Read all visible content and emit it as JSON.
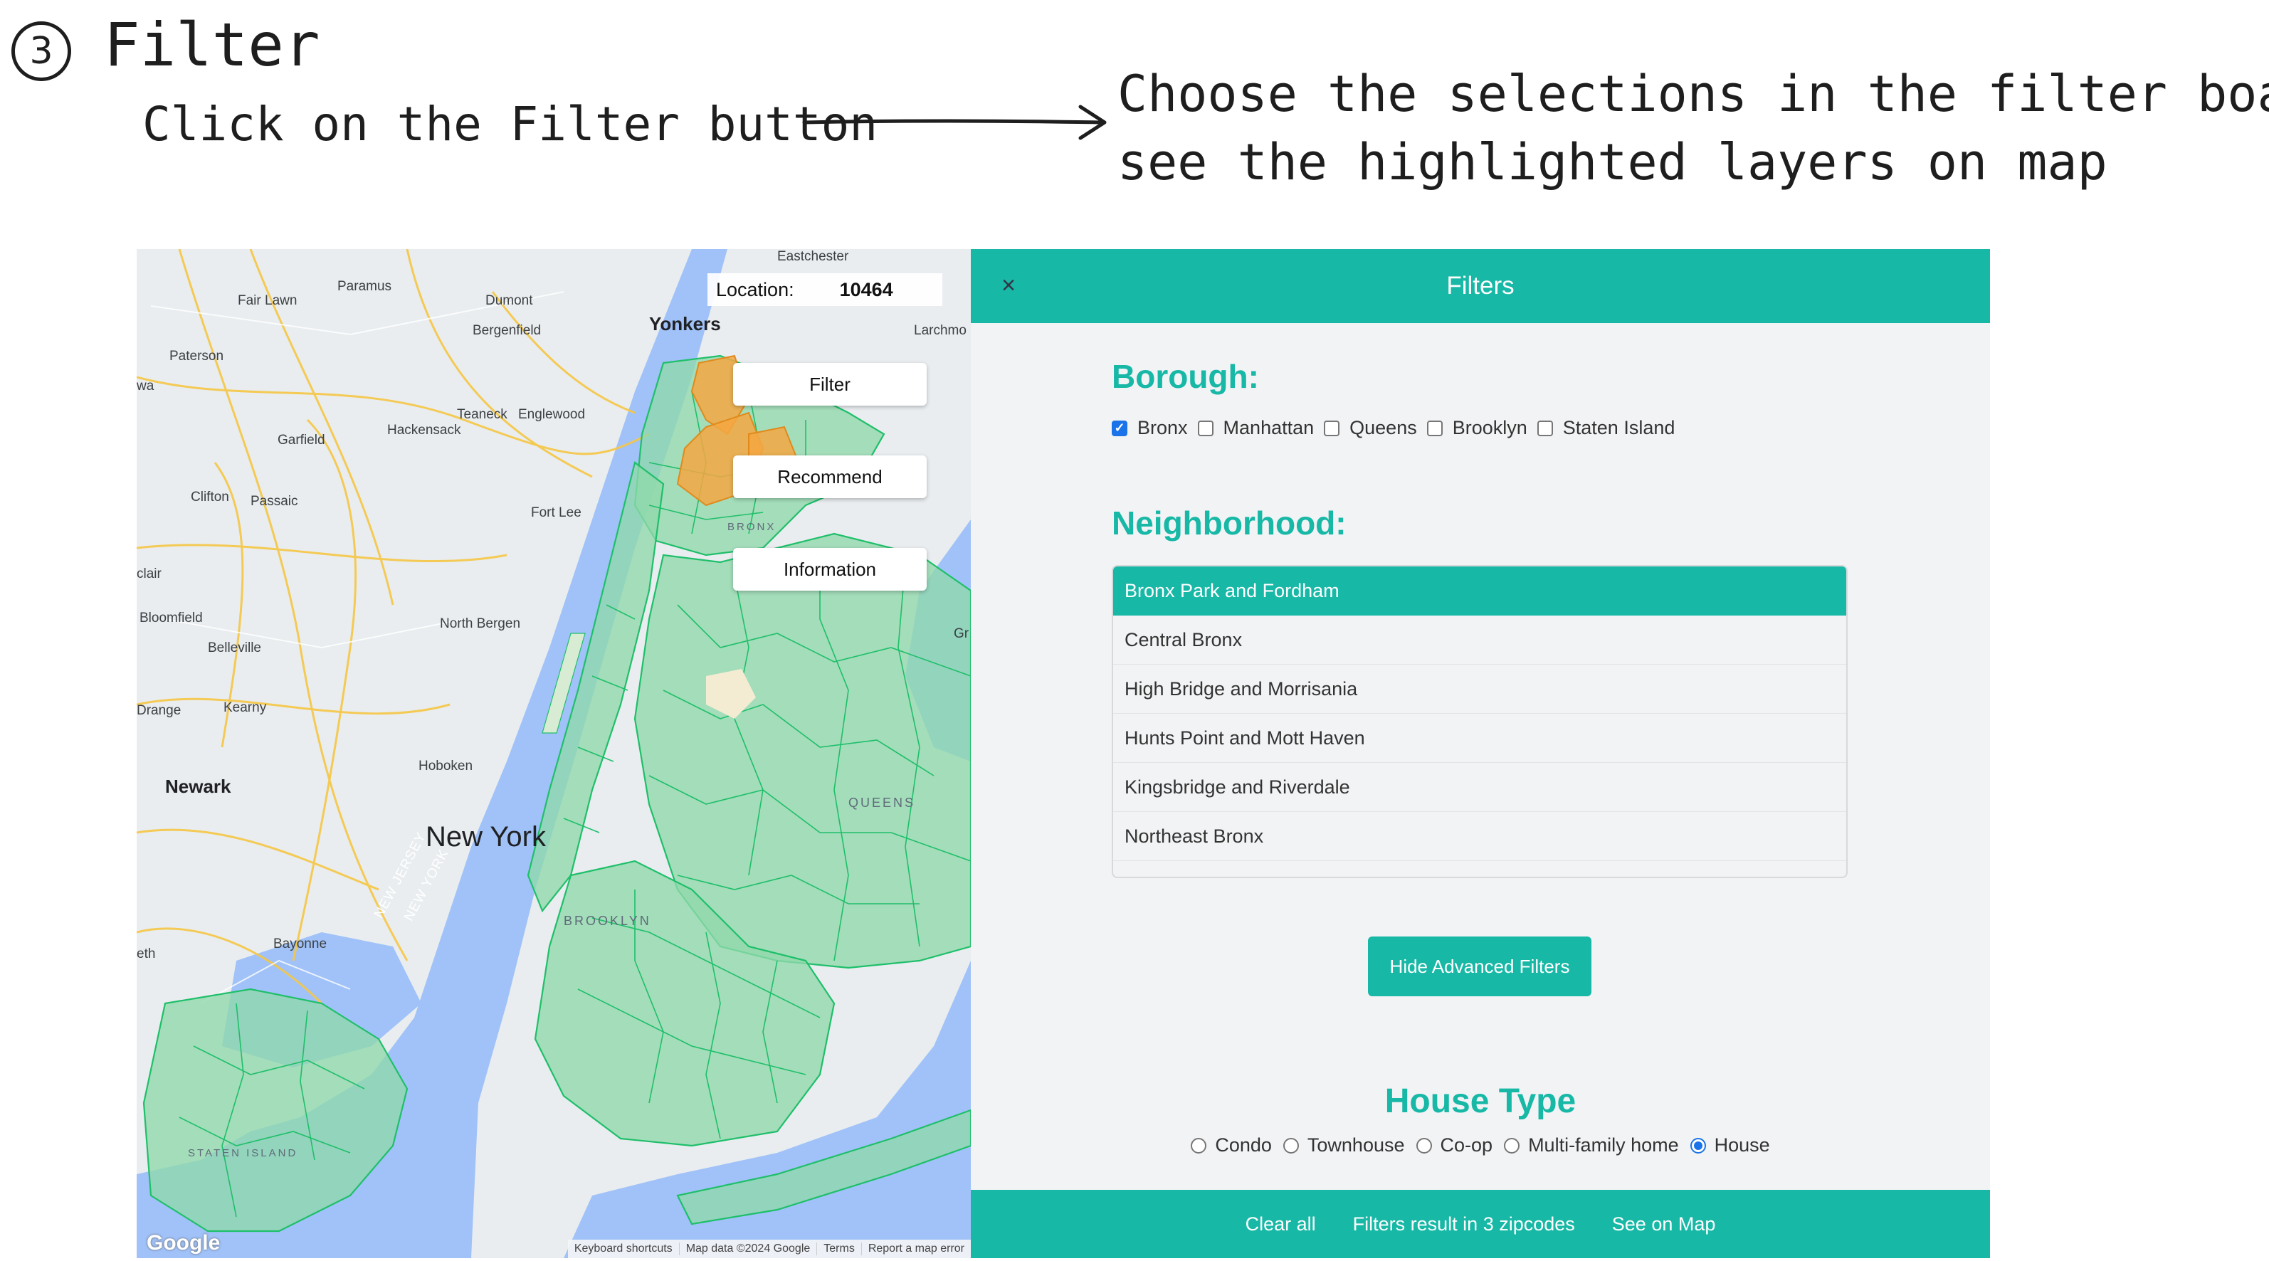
{
  "annotation": {
    "step_number": "3",
    "step_title": "Filter",
    "left_instruction": "Click on the Filter button",
    "right_instruction_line1": "Choose the selections in the filter board,",
    "right_instruction_line2": "see the highlighted layers on map"
  },
  "map": {
    "location_label": "Location:",
    "location_value": "10464",
    "buttons": {
      "filter": "Filter",
      "recommend": "Recommend",
      "information": "Information"
    },
    "labels": {
      "eastchester": "Eastchester",
      "fair_lawn": "Fair Lawn",
      "paramus": "Paramus",
      "dumont": "Dumont",
      "bergenfield": "Bergenfield",
      "yonkers": "Yonkers",
      "larchmont": "Larchmo",
      "paterson": "Paterson",
      "wa": "wa",
      "teaneck": "Teaneck",
      "englewood": "Englewood",
      "hackensack": "Hackensack",
      "garfield": "Garfield",
      "clifton": "Clifton",
      "passaic": "Passaic",
      "fort_lee": "Fort Lee",
      "bronx": "BRONX",
      "clair": "clair",
      "bloomfield": "Bloomfield",
      "north_bergen": "North Bergen",
      "belleville": "Belleville",
      "gr": "Gr",
      "orange": "Drange",
      "kearny": "Kearny",
      "hoboken": "Hoboken",
      "newark": "Newark",
      "new_york": "New York",
      "queens": "QUEENS",
      "new_jersey": "NEW JERSEY",
      "new_york_state": "NEW YORK",
      "brooklyn": "BROOKLYN",
      "bayonne": "Bayonne",
      "eth": "eth",
      "staten_island": "STATEN ISLAND",
      "google": "Google"
    },
    "footer": [
      "Keyboard shortcuts",
      "Map data ©2024 Google",
      "Terms",
      "Report a map error"
    ],
    "colors": {
      "water": "#a0c2f8",
      "zone": "#8fd9ab",
      "zone_border": "#1fbf6a",
      "highlight": "#f5a742",
      "road": "#f6c744"
    }
  },
  "panel": {
    "title": "Filters",
    "close_icon": "×",
    "borough_heading": "Borough:",
    "boroughs": [
      {
        "label": "Bronx",
        "checked": true
      },
      {
        "label": "Manhattan",
        "checked": false
      },
      {
        "label": "Queens",
        "checked": false
      },
      {
        "label": "Brooklyn",
        "checked": false
      },
      {
        "label": "Staten Island",
        "checked": false
      }
    ],
    "neighborhood_heading": "Neighborhood:",
    "neighborhoods": [
      "Bronx Park and Fordham",
      "Central Bronx",
      "High Bridge and Morrisania",
      "Hunts Point and Mott Haven",
      "Kingsbridge and Riverdale",
      "Northeast Bronx"
    ],
    "selected_neighborhood": "Bronx Park and Fordham",
    "advanced_button": "Hide Advanced Filters",
    "house_type_heading": "House Type",
    "house_types": [
      {
        "label": "Condo",
        "selected": false
      },
      {
        "label": "Townhouse",
        "selected": false
      },
      {
        "label": "Co-op",
        "selected": false
      },
      {
        "label": "Multi-family home",
        "selected": false
      },
      {
        "label": "House",
        "selected": true
      }
    ],
    "footer": {
      "clear": "Clear all",
      "result": "Filters result in 3 zipcodes",
      "see_map": "See on Map"
    },
    "accent": "#17b8a6"
  }
}
